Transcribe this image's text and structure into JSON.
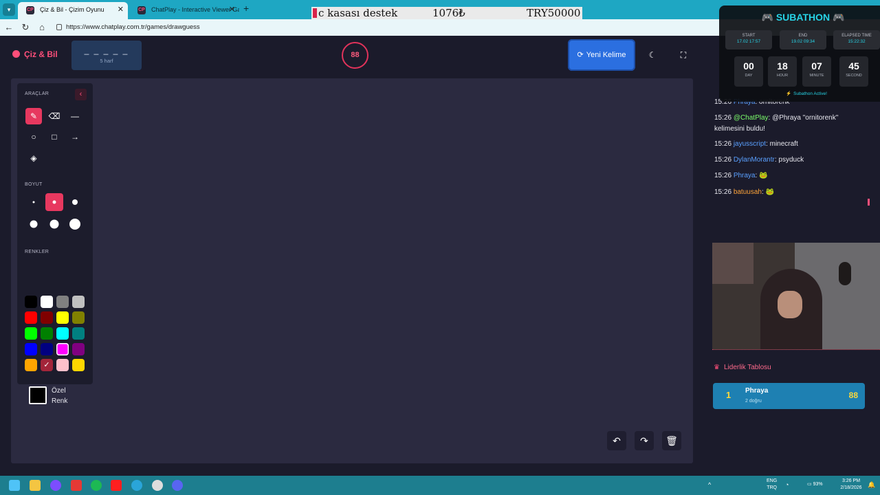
{
  "browser": {
    "tabs": [
      {
        "label": "Çiz & Bil - Çizim Oyunu",
        "favicon": "CP"
      },
      {
        "label": "ChatPlay - Interactive Viewer Gam",
        "favicon": "CP"
      }
    ],
    "url": "https://www.chatplay.com.tr/games/drawguess"
  },
  "ticker": {
    "a": "c kasası destek",
    "b": "1076₺",
    "c": "TRY50000"
  },
  "header": {
    "brand": "Çiz & Bil",
    "word_dashes": "_ _ _ _ _",
    "word_hint": "5 harf",
    "timer": "88",
    "new_word_label": "Yeni Kelime"
  },
  "tools": {
    "tools_title": "ARAÇLAR",
    "size_title": "BOYUT",
    "colors_title": "RENKLER",
    "custom_color_label": "Özel Renk",
    "tool_icons": [
      "pencil-icon",
      "eraser-icon",
      "line-icon",
      "circle-icon",
      "rectangle-icon",
      "arrow-icon",
      "fill-icon"
    ],
    "colors": [
      "#000000",
      "#ffffff",
      "#808080",
      "#c0c0c0",
      "#ff0000",
      "#800000",
      "#ffff00",
      "#808000",
      "#00ff00",
      "#008000",
      "#00ffff",
      "#008080",
      "#0000ff",
      "#000080",
      "#ff00ff",
      "#800080",
      "#ffa500",
      "#a52a2a",
      "#ffc0cb",
      "#ffd700"
    ]
  },
  "chat": {
    "messages": [
      {
        "time": "15:26",
        "user": "Phraya",
        "color": "#5aa0ff",
        "text": ": ornitorenk"
      },
      {
        "time": "15:26",
        "user": "@ChatPlay",
        "color": "#7cff6b",
        "text": ": @Phraya \"ornitorenk\" kelimesini buldu!"
      },
      {
        "time": "15:26",
        "user": "jayusscript",
        "color": "#5aa0ff",
        "text": ": minecraft"
      },
      {
        "time": "15:26",
        "user": "DylanMorantr",
        "color": "#5aa0ff",
        "text": ": psyduck"
      },
      {
        "time": "15:26",
        "user": "Phraya",
        "color": "#5aa0ff",
        "text": ": 🐸"
      },
      {
        "time": "15:26",
        "user": "batuusah",
        "color": "#ffa53a",
        "text": ": 🐸"
      }
    ]
  },
  "leaderboard": {
    "title": "Liderlik Tablosu",
    "rows": [
      {
        "rank": "1",
        "name": "Phraya",
        "sub": "2 doğru",
        "score": "88"
      }
    ]
  },
  "subathon": {
    "title": "SUBATHON",
    "start_label": "START",
    "start_value": "17.02 17:57",
    "end_label": "END",
    "end_value": "19.02 09:34",
    "elapsed_label": "ELAPSED TIME",
    "elapsed_value": "15:22:32",
    "countdown": [
      {
        "n": "00",
        "u": "DAY"
      },
      {
        "n": "18",
        "u": "HOUR"
      },
      {
        "n": "07",
        "u": "MINUTE"
      },
      {
        "n": "45",
        "u": "SECOND"
      }
    ],
    "status": "Subathon Active!"
  },
  "taskbar": {
    "lang1": "ENG",
    "lang2": "TRQ",
    "battery": "93%",
    "time": "3:26 PM",
    "date": "2/18/2026"
  }
}
